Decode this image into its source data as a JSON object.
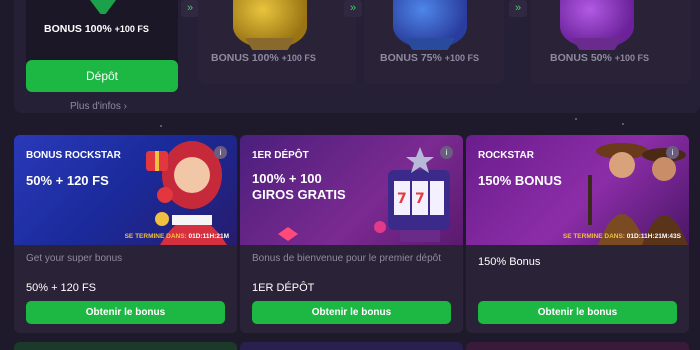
{
  "tiers": [
    {
      "pct": "BONUS 100%",
      "fs": "+100 FS"
    },
    {
      "pct": "BONUS 100%",
      "fs": "+100 FS"
    },
    {
      "pct": "BONUS 75%",
      "fs": "+100 FS"
    },
    {
      "pct": "BONUS 50%",
      "fs": "+100 FS"
    }
  ],
  "deposit_label": "Dépôt",
  "more_info": "Plus d'infos ›",
  "chevron": "»",
  "info_icon": "i",
  "cards": [
    {
      "title": "BONUS ROCKSTAR",
      "offer": "50% + 120 FS",
      "timer_prefix": "SE TERMINE DANS:",
      "timer": "01D:11H:21M",
      "description": "Get your super bonus",
      "value": "50% + 120 FS",
      "button": "Obtenir le bonus"
    },
    {
      "title": "1ER DÉPÔT",
      "offer_line1": "100% + 100",
      "offer_line2": "GIROS GRATIS",
      "description": "Bonus de bienvenue pour le premier dépôt",
      "value": "1ER DÉPÔT",
      "button": "Obtenir le bonus"
    },
    {
      "title": "ROCKSTAR",
      "offer": "150% BONUS",
      "timer_prefix": "SE TERMINE DANS:",
      "timer": "01D:11H:21M:43S",
      "description": "150% Bonus",
      "button": "Obtenir le bonus"
    }
  ],
  "colors": {
    "accent": "#1db744",
    "bg": "#1f1a2b",
    "card": "#2a2338",
    "timer": "#f0c040"
  }
}
